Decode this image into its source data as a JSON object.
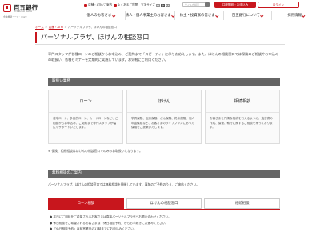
{
  "header": {
    "logo_name": "百五銀行",
    "logo_sub": "HYAKUGO BANK",
    "logo_code": "金融機関コード：0122",
    "util_stores": "店舗・ATM/ご案内",
    "util_faq": "よくあるご質問",
    "util_size": "文字サイズ",
    "size_small": "小",
    "size_medium": "中",
    "size_large": "大",
    "search_placeholder": "サイト内検索",
    "open_account": "口座開設・お申込み",
    "login": "ログイン"
  },
  "gnav": [
    "個人のお客さま",
    "法人・個人事業主のお客さま",
    "株主・投資家の皆さま",
    "百五銀行について",
    "採用情報"
  ],
  "breadcrumb": {
    "home": "ホーム",
    "stores": "店舗・ATM",
    "current": "パーソナルプラザ、ほけんの相談窓口"
  },
  "page_title": "パーソナルプラザ、ほけんの相談窓口",
  "intro": "専門スタッフが各種ローンのご相談からお申込み、ご契約まで「スピーディ」に承りお応えします。また、ほけんの相談窓口では保険のご相談やお申込みの取扱い、各種セミナーを定期的に実施しています。お気軽にご利用ください。",
  "business": {
    "header": "取扱い業務",
    "cards": [
      {
        "title": "ローン",
        "desc": "住宅ローン、多目的ローン、カードローンなど、ご相談からお申込み、ご契約まで専門スタッフが幅広くサポートいたします。"
      },
      {
        "title": "ほけん",
        "desc": "学資保険、医療保険、がん保険、終身保険、個人年金保険など、お客さまのライフプランにあった保険をご提案いたします。"
      },
      {
        "title": "相続相談",
        "desc": "お客さまを円滑な相続を行えるように、遺言書の作成、保管、執行に関するご相談を承っております。"
      }
    ],
    "note": "※ 保険、相続相談はほけんの相談窓口でのみのお取扱いとなります。"
  },
  "free_consult": {
    "header": "無料相談のご案内",
    "schedule_pre": "パーソナルプラザ、ほけんの相談窓口では無料相談を開催しています。事前のご予約のうえ、ご来店ください。",
    "tabs": [
      "ローン相談",
      "ほけんの相談窓口",
      "相続相談"
    ],
    "active_tab": 0,
    "bullets": [
      "● 平日にご相談をご希望されるお客さまは直接パーソナルプラザへお問い合わせください。",
      "● 休日相談をご希望されるお客さまは「休日相談予約」からお手続きにお進みください。",
      "● 「休日相談予約」は前営業日の17時までにお申込みください。"
    ]
  },
  "colors": {
    "brand_red": "#c8161d",
    "section_gray": "#666666"
  }
}
